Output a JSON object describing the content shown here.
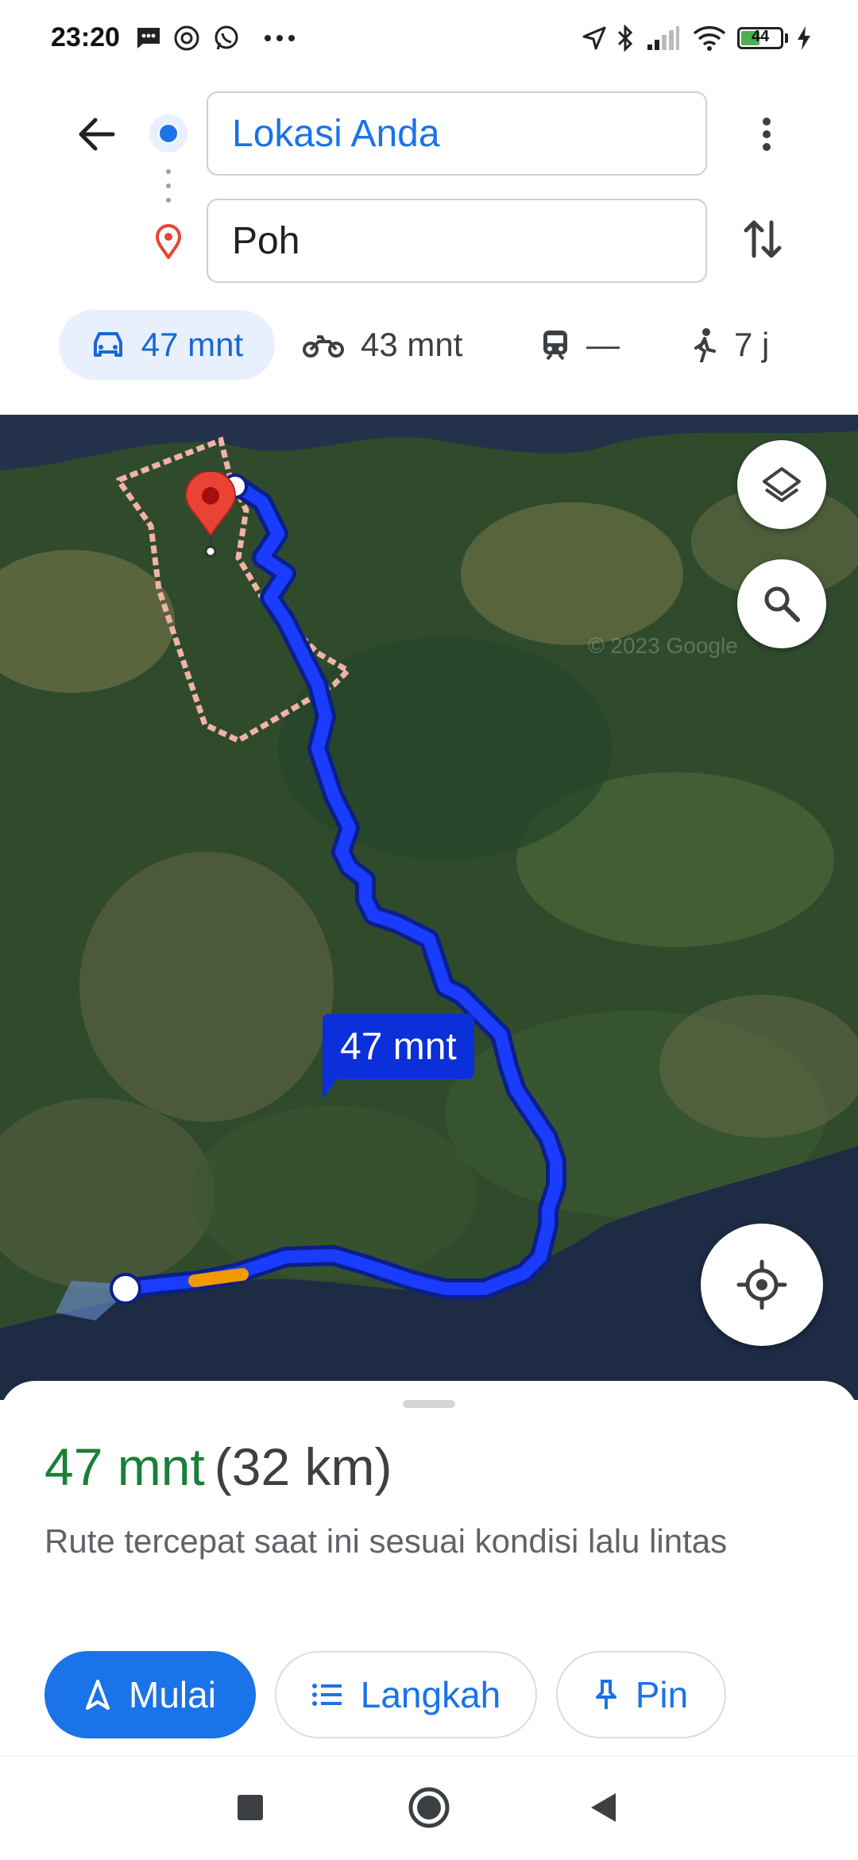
{
  "status_bar": {
    "time": "23:20",
    "battery": "44",
    "icons": [
      "message-icon",
      "at-icon",
      "whatsapp-icon",
      "more-dots-icon",
      "location-arrow-icon",
      "bluetooth-icon",
      "signal-icon",
      "wifi-icon",
      "battery-icon",
      "charging-icon"
    ]
  },
  "directions": {
    "origin": "Lokasi Anda",
    "destination": "Poh"
  },
  "modes": [
    {
      "name": "car",
      "label": "47 mnt",
      "selected": true
    },
    {
      "name": "motorcycle",
      "label": "43 mnt"
    },
    {
      "name": "transit",
      "label": "—"
    },
    {
      "name": "walk",
      "label": "7 j"
    }
  ],
  "map": {
    "eta_label": "47 mnt",
    "watermark": "© 2023 Google"
  },
  "summary": {
    "duration": "47 mnt",
    "distance": "(32 km)",
    "description": "Rute tercepat saat ini sesuai kondisi lalu lintas"
  },
  "actions": {
    "start": "Mulai",
    "steps": "Langkah",
    "pin": "Pin"
  },
  "colors": {
    "accent": "#1a73e8",
    "route": "#1a3cff",
    "traffic": "#f29900",
    "duration_green": "#188038",
    "pin_red": "#ea4335"
  }
}
